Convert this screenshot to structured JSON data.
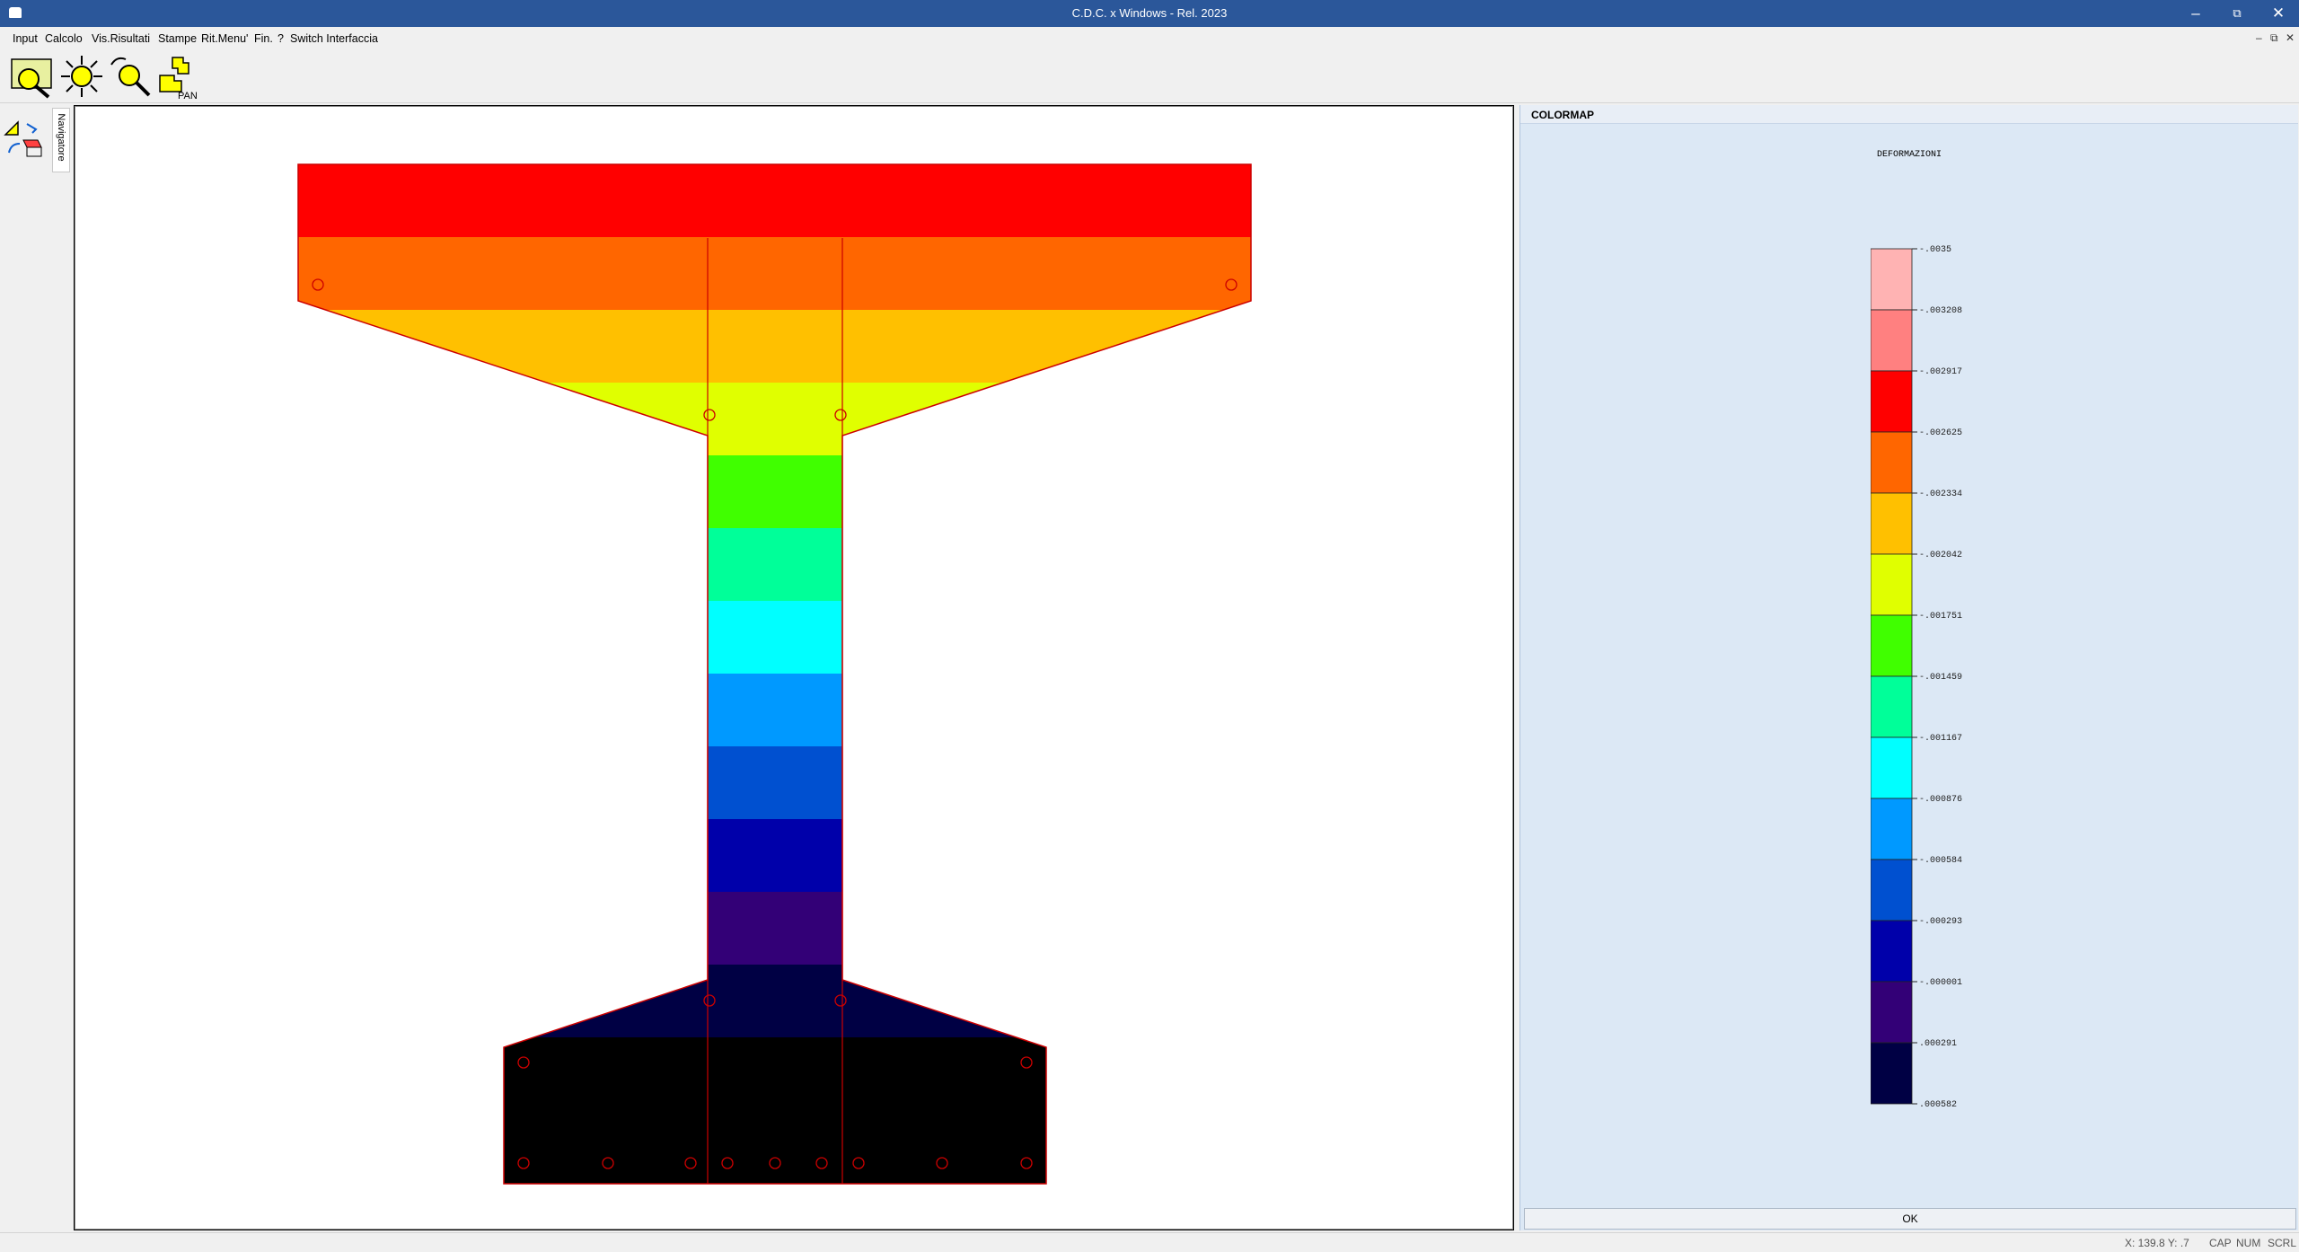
{
  "window": {
    "title": "C.D.C. x Windows - Rel. 2023",
    "controls": [
      "minimize",
      "restore",
      "close"
    ]
  },
  "menu": {
    "items": [
      "Input",
      "Calcolo",
      "Vis.Risultati",
      "Stampe",
      "Rit.Menu'",
      "Fin.",
      "?",
      "Switch Interfaccia"
    ]
  },
  "toolbar": {
    "buttons": [
      "zoom-window",
      "zoom-extents",
      "zoom-out",
      "pan"
    ],
    "pan_label": "PAN"
  },
  "sidebar": {
    "tab_label": "Navigatore"
  },
  "panel": {
    "title": "COLORMAP",
    "section_title": "DEFORMAZIONI",
    "ok_label": "OK"
  },
  "colormap": {
    "labels": [
      "-.0035",
      "-.003208",
      "-.002917",
      "-.002625",
      "-.002334",
      "-.002042",
      "-.001751",
      "-.001459",
      "-.001167",
      "-.000876",
      "-.000584",
      "-.000293",
      "-.000001",
      ".000291",
      ".000582"
    ],
    "colors": [
      "#ffb3b3",
      "#ff8080",
      "#ff0000",
      "#ff6600",
      "#ffc000",
      "#e0ff00",
      "#40ff00",
      "#00ff99",
      "#00ffff",
      "#0099ff",
      "#0050d0",
      "#0000aa",
      "#330077",
      "#000044"
    ]
  },
  "section": {
    "band_colors": [
      "#ff0000",
      "#ff6600",
      "#ffc000",
      "#e0ff00",
      "#40ff00",
      "#00ff99",
      "#00ffff",
      "#0099ff",
      "#0050d0",
      "#0000aa",
      "#330077",
      "#000044",
      "#000000",
      "#000000"
    ],
    "outline_color": "#cc0000"
  },
  "statusbar": {
    "coords": "X: 139.8  Y:  .7",
    "cap": "CAP",
    "num": "NUM",
    "scrl": "SCRL"
  }
}
